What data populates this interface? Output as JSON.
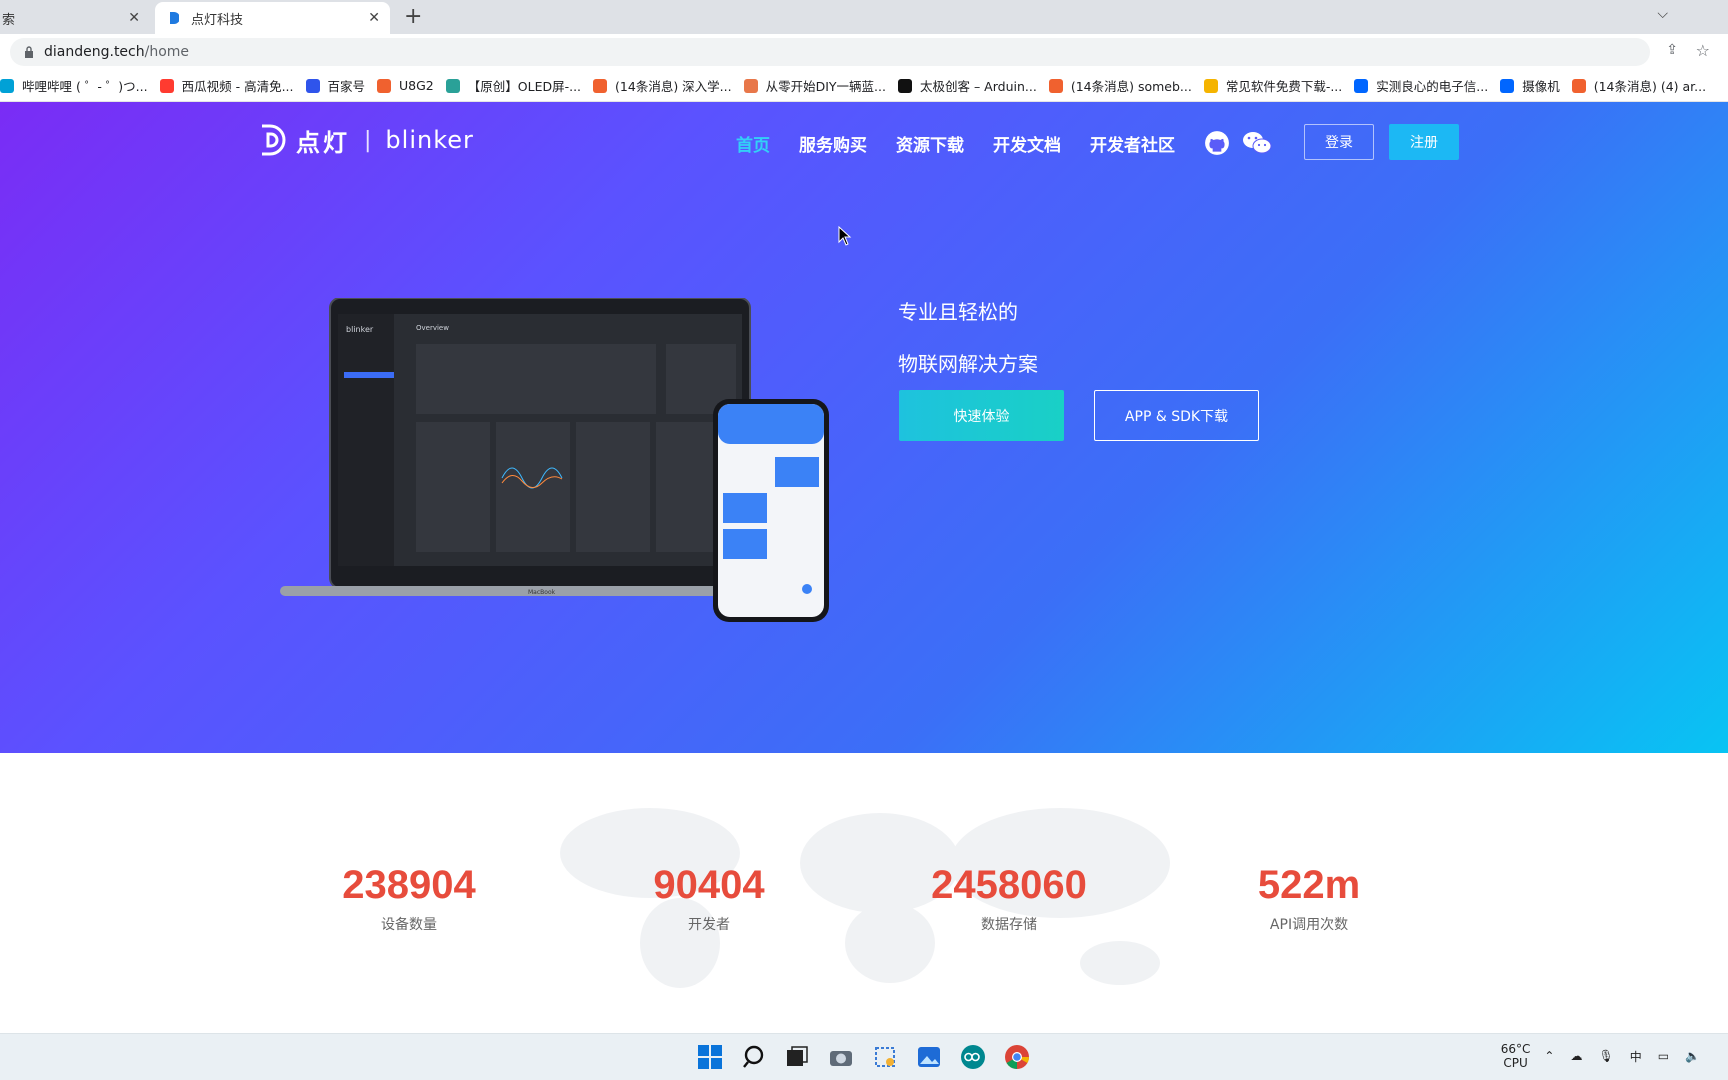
{
  "browser": {
    "tab_partial_label": "索",
    "active_tab_title": "点灯科技",
    "url_host": "diandeng.tech",
    "url_path": "/home",
    "bookmarks": [
      {
        "label": "哔哩哔哩 ( ゜- ゜)つ...",
        "color": "#00a1d6",
        "icon": "bilibili-icon"
      },
      {
        "label": "西瓜视频 - 高清免...",
        "color": "#ff3b30",
        "icon": "xigua-icon"
      },
      {
        "label": "百家号",
        "color": "#2f54eb",
        "icon": "baijiahao-icon"
      },
      {
        "label": "U8G2",
        "color": "#f0612f",
        "icon": "csdn-icon"
      },
      {
        "label": "【原创】OLED屏-...",
        "color": "#2aa198",
        "icon": "link-icon"
      },
      {
        "label": "(14条消息) 深入学...",
        "color": "#f0612f",
        "icon": "csdn-icon"
      },
      {
        "label": "从零开始DIY一辆蓝...",
        "color": "#e8774a",
        "icon": "page-icon"
      },
      {
        "label": "太极创客 – Arduin...",
        "color": "#111111",
        "icon": "taiji-icon"
      },
      {
        "label": "(14条消息) someb...",
        "color": "#f0612f",
        "icon": "csdn-icon"
      },
      {
        "label": "常见软件免费下载-...",
        "color": "#f5b400",
        "icon": "download-site-icon"
      },
      {
        "label": "实测良心的电子信...",
        "color": "#0066ff",
        "icon": "zhihu-icon"
      },
      {
        "label": "摄像机",
        "color": "#0066ff",
        "icon": "zhihu-icon"
      },
      {
        "label": "(14条消息) (4) ar...",
        "color": "#f0612f",
        "icon": "csdn-icon"
      }
    ]
  },
  "header": {
    "logo_cn": "点灯",
    "logo_sep": "|",
    "logo_en": "blinker",
    "nav": [
      {
        "label": "首页",
        "active": true
      },
      {
        "label": "服务购买",
        "active": false
      },
      {
        "label": "资源下载",
        "active": false
      },
      {
        "label": "开发文档",
        "active": false
      },
      {
        "label": "开发者社区",
        "active": false
      }
    ],
    "login_label": "登录",
    "register_label": "注册"
  },
  "hero": {
    "slogan_line1": "专业且轻松的",
    "slogan_line2": "物联网解决方案",
    "try_button": "快速体验",
    "download_button": "APP & SDK下载",
    "laptop_brand": "blinker",
    "laptop_screen_title": "Overview",
    "laptop_label": "MacBook"
  },
  "stats": [
    {
      "value": "238904",
      "label": "设备数量"
    },
    {
      "value": "90404",
      "label": "开发者"
    },
    {
      "value": "2458060",
      "label": "数据存储"
    },
    {
      "value": "522m",
      "label": "API调用次数"
    }
  ],
  "taskbar": {
    "temp": "66°C",
    "temp_label": "CPU",
    "ime": "中"
  },
  "colors": {
    "accent_stat": "#e74c3c",
    "nav_active": "#33d0f7",
    "register_bg": "#1cb8f4"
  }
}
